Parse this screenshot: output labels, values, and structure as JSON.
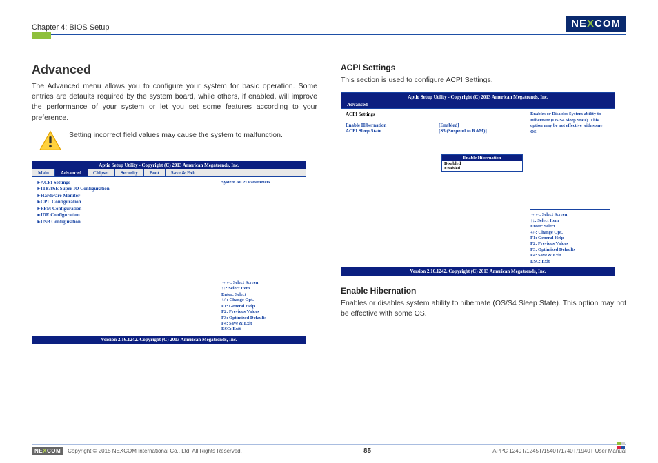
{
  "header": {
    "chapter": "Chapter 4: BIOS Setup",
    "logo_left": "NE",
    "logo_mid": "X",
    "logo_right": "COM"
  },
  "left_column": {
    "heading": "Advanced",
    "intro": "The Advanced menu allows you to configure your system for basic operation. Some entries are defaults required by the system board, while others, if enabled, will improve the performance of your system or let you set some features according to your preference.",
    "warning": "Setting incorrect field values may cause the system to malfunction."
  },
  "bios1": {
    "title": "Aptio Setup Utility - Copyright (C) 2013 American Megatrends, Inc.",
    "tabs": [
      "Main",
      "Advanced",
      "Chipset",
      "Security",
      "Boot",
      "Save & Exit"
    ],
    "active_tab": "Advanced",
    "items": [
      "ACPI Settings",
      "IT8786E Super IO Configuration",
      "Hardware Monitor",
      "CPU Configuration",
      "PPM Configuration",
      "IDE Configuration",
      "USB Configuration"
    ],
    "help": "System ACPI Parameters.",
    "keys": [
      "→←: Select Screen",
      "↑↓: Select Item",
      "Enter: Select",
      "+/-: Change Opt.",
      "F1: General Help",
      "F2: Previous Values",
      "F3: Optimized Defaults",
      "F4: Save & Exit",
      "ESC: Exit"
    ],
    "version": "Version 2.16.1242. Copyright (C) 2013 American Megatrends, Inc."
  },
  "right_column": {
    "heading": "ACPI Settings",
    "intro": "This section is used to configure ACPI Settings.",
    "sub_heading": "Enable Hibernation",
    "sub_text": "Enables or disables system ability to hibernate (OS/S4 Sleep State). This option may not be effective with some OS."
  },
  "bios2": {
    "title": "Aptio Setup Utility - Copyright (C) 2013 American Megatrends, Inc.",
    "tab": "Advanced",
    "section": "ACPI Settings",
    "settings": [
      {
        "k": "Enable Hibernation",
        "v": "[Enabled]"
      },
      {
        "k": "ACPI Sleep State",
        "v": "[S3 (Suspend to RAM)]"
      }
    ],
    "help": "Enables or Disables System ability to Hibernate (OS/S4 Sleep State). This option may be not effective with some OS.",
    "popup_title": "Enable Hibernation",
    "popup_opts": [
      "Disabled",
      "Enabled"
    ],
    "keys": [
      "→←: Select Screen",
      "↑↓: Select Item",
      "Enter: Select",
      "+/-: Change Opt.",
      "F1: General Help",
      "F2: Previous Values",
      "F3: Optimized Defaults",
      "F4: Save & Exit",
      "ESC: Exit"
    ],
    "version": "Version 2.16.1242. Copyright (C) 2013 American Megatrends, Inc."
  },
  "footer": {
    "copyright": "Copyright © 2015 NEXCOM International Co., Ltd. All Rights Reserved.",
    "page_num": "85",
    "manual": "APPC 1240T/1245T/1540T/1740T/1940T User Manual"
  }
}
